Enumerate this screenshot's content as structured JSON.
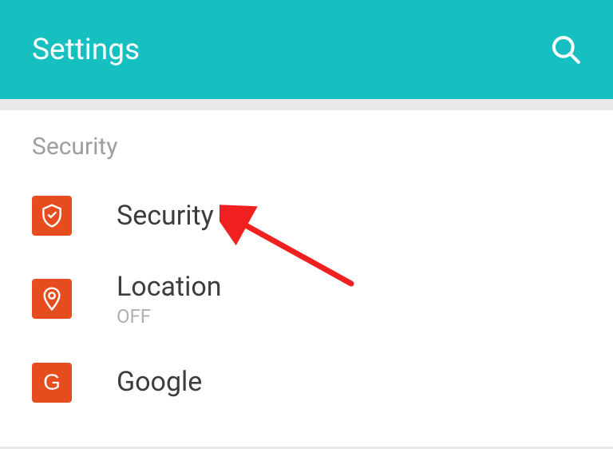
{
  "header": {
    "title": "Settings"
  },
  "section": {
    "header": "Security"
  },
  "items": [
    {
      "label": "Security",
      "sublabel": null
    },
    {
      "label": "Location",
      "sublabel": "OFF"
    },
    {
      "label": "Google",
      "sublabel": null
    }
  ]
}
